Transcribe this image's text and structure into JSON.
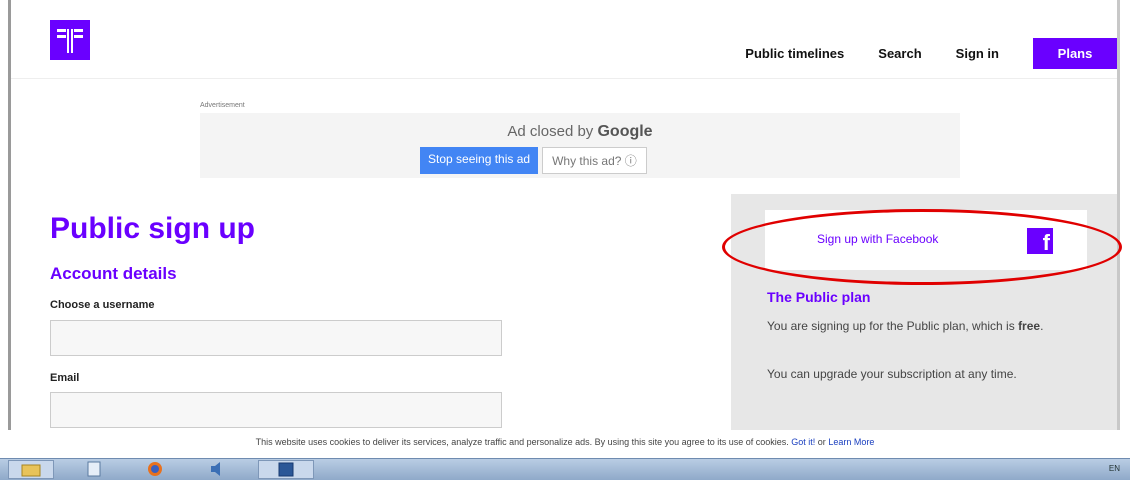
{
  "header": {
    "nav": [
      "Public timelines",
      "Search",
      "Sign in"
    ],
    "plans_button": "Plans",
    "brand_color": "#6a00ff"
  },
  "ad": {
    "label": "Advertisement",
    "closed_text": "Ad closed by",
    "provider": "Google",
    "stop_button": "Stop seeing this ad",
    "why_button": "Why this ad? ⓘ"
  },
  "main": {
    "title": "Public sign up",
    "section_title": "Account details",
    "username_label": "Choose a username",
    "username_value": "",
    "email_label": "Email",
    "email_value": ""
  },
  "sidebar": {
    "facebook_button": "Sign up with Facebook",
    "facebook_icon": "f",
    "plan_title": "The Public plan",
    "plan_text_1": "You are signing up for the Public plan, which is",
    "plan_text_1_bold": "free",
    "plan_text_1_end": ".",
    "plan_text_2": "You can upgrade your subscription at any time.",
    "annotation_color": "#e00000"
  },
  "cookie": {
    "text": "This website uses cookies to deliver its services, analyze traffic and personalize ads. By using this site you agree to its use of cookies.",
    "got_it": "Got it!",
    "or": "or",
    "learn_more": "Learn More"
  },
  "taskbar": {
    "items": [
      "folder-icon",
      "document-icon",
      "firefox-icon",
      "speaker-icon",
      "word-icon"
    ],
    "tray_lang": "EN"
  }
}
